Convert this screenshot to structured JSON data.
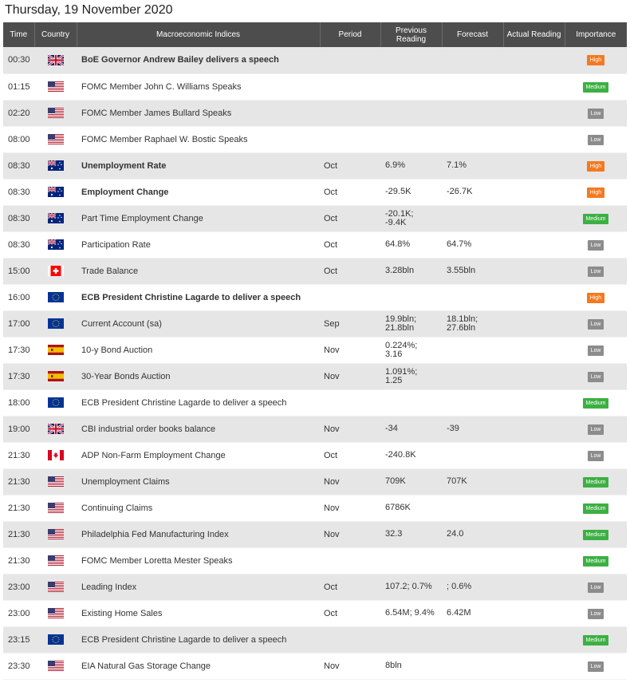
{
  "page": {
    "title": "Thursday, 19 November 2020"
  },
  "columns": {
    "time": "Time",
    "country": "Country",
    "indices": "Macroeconomic Indices",
    "period": "Period",
    "previous": "Previous\nReading",
    "forecast": "Forecast",
    "actual": "Actual Reading",
    "importance": "Importance"
  },
  "colors": {
    "high": "#f47920",
    "medium": "#3cb043",
    "low": "#8c8c8c",
    "header": "#4d4d4d"
  },
  "rows": [
    {
      "time": "00:30",
      "flag": "uk-flag-icon",
      "indicator": "BoE Governor Andrew Bailey delivers a speech",
      "bold": true,
      "period": "",
      "previous": "",
      "forecast": "",
      "actual": "",
      "importance": "High"
    },
    {
      "time": "01:15",
      "flag": "us-flag-icon",
      "indicator": "FOMC Member John C. Williams Speaks",
      "bold": false,
      "period": "",
      "previous": "",
      "forecast": "",
      "actual": "",
      "importance": "Medium"
    },
    {
      "time": "02:20",
      "flag": "us-flag-icon",
      "indicator": "FOMC Member James Bullard Speaks",
      "bold": false,
      "period": "",
      "previous": "",
      "forecast": "",
      "actual": "",
      "importance": "Low"
    },
    {
      "time": "08:00",
      "flag": "us-flag-icon",
      "indicator": "FOMC Member Raphael W. Bostic Speaks",
      "bold": false,
      "period": "",
      "previous": "",
      "forecast": "",
      "actual": "",
      "importance": "Low"
    },
    {
      "time": "08:30",
      "flag": "au-flag-icon",
      "indicator": "Unemployment Rate",
      "bold": true,
      "period": "Oct",
      "previous": "6.9%",
      "forecast": "7.1%",
      "actual": "",
      "importance": "High"
    },
    {
      "time": "08:30",
      "flag": "au-flag-icon",
      "indicator": "Employment Change",
      "bold": true,
      "period": "Oct",
      "previous": "-29.5K",
      "forecast": "-26.7K",
      "actual": "",
      "importance": "High"
    },
    {
      "time": "08:30",
      "flag": "au-flag-icon",
      "indicator": "Part Time Employment Change",
      "bold": false,
      "period": "Oct",
      "previous": "-20.1K;\n-9.4K",
      "forecast": "",
      "actual": "",
      "importance": "Medium"
    },
    {
      "time": "08:30",
      "flag": "au-flag-icon",
      "indicator": "Participation Rate",
      "bold": false,
      "period": "Oct",
      "previous": "64.8%",
      "forecast": "64.7%",
      "actual": "",
      "importance": "Low"
    },
    {
      "time": "15:00",
      "flag": "ch-flag-icon",
      "indicator": "Trade Balance",
      "bold": false,
      "period": "Oct",
      "previous": "3.28bln",
      "forecast": "3.55bln",
      "actual": "",
      "importance": "Low"
    },
    {
      "time": "16:00",
      "flag": "eu-flag-icon",
      "indicator": "ECB President Christine Lagarde to deliver a speech",
      "bold": true,
      "period": "",
      "previous": "",
      "forecast": "",
      "actual": "",
      "importance": "High"
    },
    {
      "time": "17:00",
      "flag": "eu-flag-icon",
      "indicator": "Current Account (sa)",
      "bold": false,
      "period": "Sep",
      "previous": "19.9bln;\n21.8bln",
      "forecast": "18.1bln;\n27.6bln",
      "actual": "",
      "importance": "Low"
    },
    {
      "time": "17:30",
      "flag": "es-flag-icon",
      "indicator": "10-y Bond Auction",
      "bold": false,
      "period": "Nov",
      "previous": "0.224%;\n3.16",
      "forecast": "",
      "actual": "",
      "importance": "Low"
    },
    {
      "time": "17:30",
      "flag": "es-flag-icon",
      "indicator": "30-Year Bonds Auction",
      "bold": false,
      "period": "Nov",
      "previous": "1.091%;\n1.25",
      "forecast": "",
      "actual": "",
      "importance": "Low"
    },
    {
      "time": "18:00",
      "flag": "eu-flag-icon",
      "indicator": "ECB President Christine Lagarde to deliver a speech",
      "bold": false,
      "period": "",
      "previous": "",
      "forecast": "",
      "actual": "",
      "importance": "Medium"
    },
    {
      "time": "19:00",
      "flag": "uk-flag-icon",
      "indicator": "CBI industrial order books balance",
      "bold": false,
      "period": "Nov",
      "previous": "-34",
      "forecast": "-39",
      "actual": "",
      "importance": "Low"
    },
    {
      "time": "21:30",
      "flag": "ca-flag-icon",
      "indicator": "ADP Non-Farm Employment Change",
      "bold": false,
      "period": "Oct",
      "previous": "-240.8K",
      "forecast": "",
      "actual": "",
      "importance": "Low"
    },
    {
      "time": "21:30",
      "flag": "us-flag-icon",
      "indicator": "Unemployment Claims",
      "bold": false,
      "period": "Nov",
      "previous": "709K",
      "forecast": "707K",
      "actual": "",
      "importance": "Medium"
    },
    {
      "time": "21:30",
      "flag": "us-flag-icon",
      "indicator": "Continuing Claims",
      "bold": false,
      "period": "Nov",
      "previous": "6786K",
      "forecast": "",
      "actual": "",
      "importance": "Medium"
    },
    {
      "time": "21:30",
      "flag": "us-flag-icon",
      "indicator": "Philadelphia Fed Manufacturing Index",
      "bold": false,
      "period": "Nov",
      "previous": "32.3",
      "forecast": "24.0",
      "actual": "",
      "importance": "Medium"
    },
    {
      "time": "21:30",
      "flag": "us-flag-icon",
      "indicator": "FOMC Member Loretta Mester Speaks",
      "bold": false,
      "period": "",
      "previous": "",
      "forecast": "",
      "actual": "",
      "importance": "Medium"
    },
    {
      "time": "23:00",
      "flag": "us-flag-icon",
      "indicator": "Leading Index",
      "bold": false,
      "period": "Oct",
      "previous": "107.2; 0.7%",
      "forecast": "; 0.6%",
      "actual": "",
      "importance": "Low"
    },
    {
      "time": "23:00",
      "flag": "us-flag-icon",
      "indicator": "Existing Home Sales",
      "bold": false,
      "period": "Oct",
      "previous": "6.54M; 9.4%",
      "forecast": "6.42M",
      "actual": "",
      "importance": "Low"
    },
    {
      "time": "23:15",
      "flag": "eu-flag-icon",
      "indicator": "ECB President Christine Lagarde to deliver a speech",
      "bold": false,
      "period": "",
      "previous": "",
      "forecast": "",
      "actual": "",
      "importance": "Medium"
    },
    {
      "time": "23:30",
      "flag": "us-flag-icon",
      "indicator": "EIA Natural Gas Storage Change",
      "bold": false,
      "period": "Nov",
      "previous": "8bln",
      "forecast": "",
      "actual": "",
      "importance": "Low"
    }
  ]
}
